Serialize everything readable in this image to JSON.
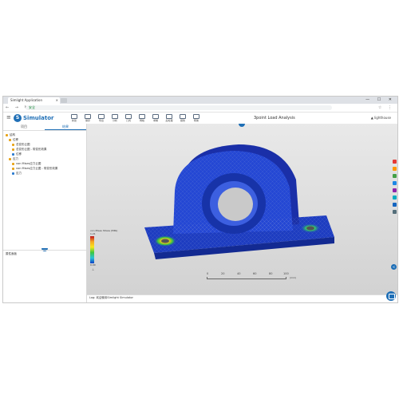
{
  "browser": {
    "tab_title": "Simlight Application",
    "url": "安全",
    "nav_icons": [
      "back-icon",
      "forward-icon",
      "reload-icon"
    ],
    "window_controls": [
      "minimize-icon",
      "maximize-icon",
      "close-icon"
    ]
  },
  "app": {
    "brand": "Simulator",
    "brand_color": "#1f6fb6",
    "document_title": "3point Load Analysis",
    "user": "lighthouse",
    "tools": [
      {
        "label": "新建"
      },
      {
        "label": "保存"
      },
      {
        "label": "导出"
      },
      {
        "label": "分析"
      },
      {
        "label": "几何"
      },
      {
        "label": "网格"
      },
      {
        "label": "求解"
      },
      {
        "label": "后处理"
      },
      {
        "label": "报告"
      },
      {
        "label": "帮助"
      }
    ]
  },
  "sidebar": {
    "tabs": [
      "项目",
      "结果"
    ],
    "active_tab": "结果",
    "tree": [
      {
        "label": "结构",
        "color": "#e8a317"
      },
      {
        "label": "位移",
        "color": "#e8a317"
      },
      {
        "label": "总变形云图",
        "color": "#e8a317"
      },
      {
        "label": "总变形云图 - 带变形效果",
        "color": "#e8a317"
      },
      {
        "label": "位移",
        "color": "#2b7bd0"
      },
      {
        "label": "应力",
        "color": "#e8a317"
      },
      {
        "label": "von Mises应力云图",
        "color": "#e8a317"
      },
      {
        "label": "von Mises应力云图 - 带变形效果",
        "color": "#e8a317"
      },
      {
        "label": "应力",
        "color": "#2b7bd0"
      }
    ],
    "bottom_title": "属性面板"
  },
  "viewport": {
    "legend_title": "von Mises Stress (MPa)",
    "legend_max": "1.21",
    "legend_min": "0.00",
    "scale_ticks": [
      "0",
      "20",
      "40",
      "60",
      "80",
      "100"
    ],
    "scale_unit": "(mm)"
  },
  "log": {
    "text": "Log: 欢迎使用Simlight Simulator"
  },
  "right_tools": [
    "view-icon",
    "fit-icon",
    "zoom-icon",
    "rotate-icon",
    "section-icon",
    "measure-icon",
    "light-icon",
    "mesh-icon"
  ]
}
